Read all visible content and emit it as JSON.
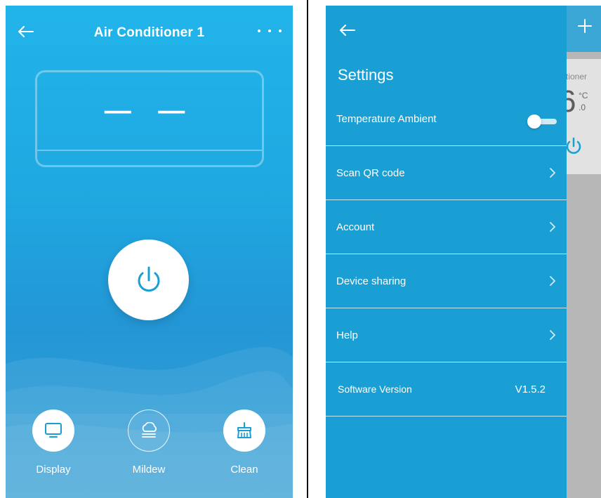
{
  "left_screen": {
    "title": "Air Conditioner 1",
    "display_temp": "— —",
    "functions": [
      {
        "label": "Display",
        "icon": "monitor-icon"
      },
      {
        "label": "Mildew",
        "icon": "cloud-mildew-icon"
      },
      {
        "label": "Clean",
        "icon": "brush-clean-icon"
      }
    ]
  },
  "right_screen": {
    "title": "Settings",
    "toggle_row": {
      "label": "Temperature Ambient",
      "enabled": false
    },
    "menu_items": [
      {
        "label": "Scan QR code"
      },
      {
        "label": "Account"
      },
      {
        "label": "Device sharing"
      },
      {
        "label": "Help"
      }
    ],
    "version_row": {
      "label": "Software Version",
      "value": "V1.5.2"
    },
    "background_card": {
      "name_fragment": "tioner",
      "temp_fragment": "6",
      "unit": "°C",
      "decimal": ".0"
    }
  },
  "colors": {
    "primary_blue": "#1a9fd5",
    "sky_blue": "#21b4ea",
    "white": "#ffffff"
  }
}
